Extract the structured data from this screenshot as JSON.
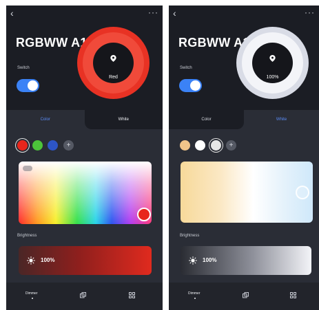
{
  "colors": {
    "accent": "#3b82f6",
    "tab_active": "#5b8cf7",
    "red": "#e8261c",
    "dark_bg": "#1b1d24"
  },
  "screens": [
    {
      "device_title": "RGBWW A19",
      "switch_label": "Switch",
      "dial_text": "Red",
      "tabs": {
        "color": "Color",
        "white": "White",
        "active": "color"
      },
      "swatches": [
        "#e8261c",
        "#4cc43a",
        "#2d55c6"
      ],
      "brightness_label": "Brightness",
      "brightness_value": "100%",
      "nav": {
        "home_label": "Dimmer"
      }
    },
    {
      "device_title": "RGBWW A19",
      "switch_label": "Switch",
      "dial_text": "100%",
      "tabs": {
        "color": "Color",
        "white": "White",
        "active": "white"
      },
      "swatches": [
        "#f0c48a",
        "#ffffff",
        "#e6e6e6"
      ],
      "brightness_label": "Brightness",
      "brightness_value": "100%",
      "nav": {
        "home_label": "Dimmer"
      }
    }
  ]
}
